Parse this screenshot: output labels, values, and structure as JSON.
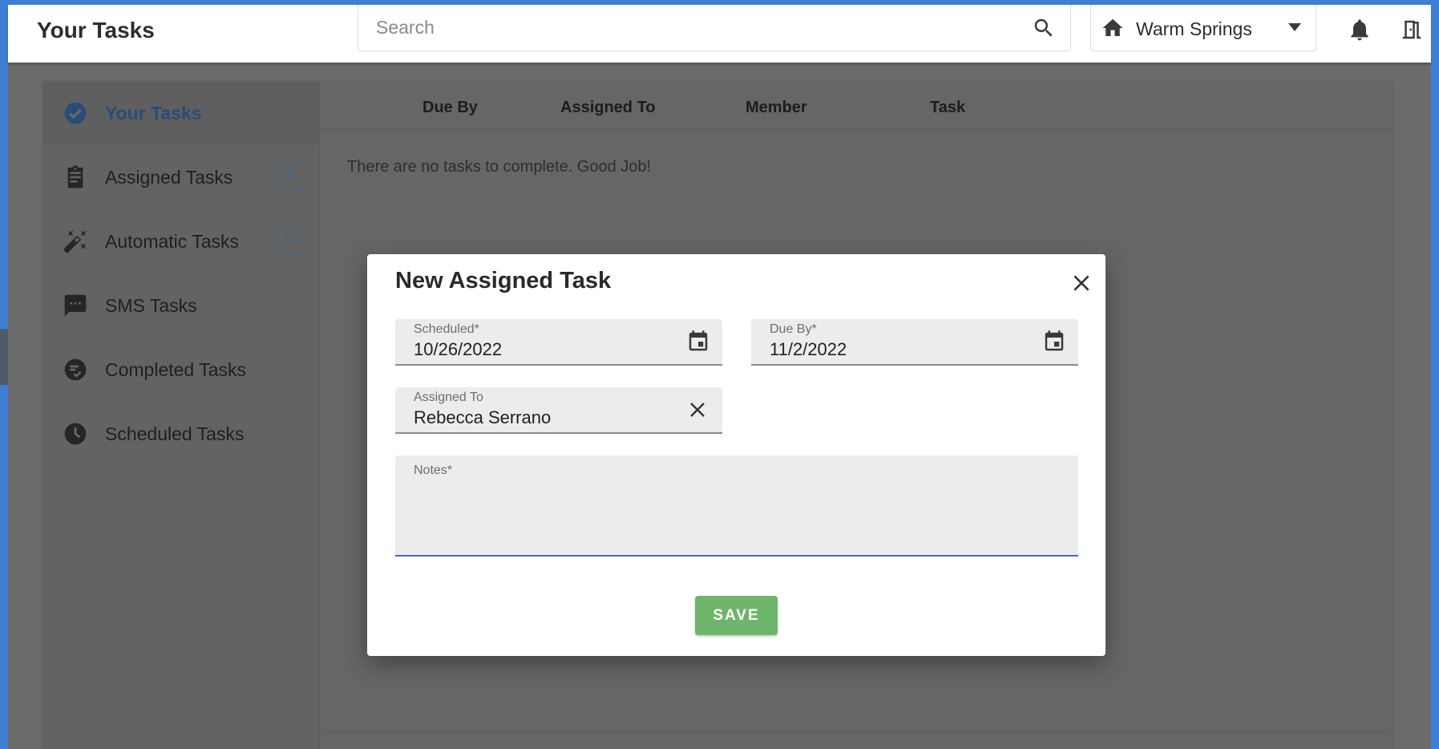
{
  "header": {
    "title": "Your Tasks",
    "search_placeholder": "Search",
    "location": "Warm Springs"
  },
  "sidebar": {
    "items": [
      {
        "label": "Your Tasks",
        "icon": "check-circle-icon",
        "active": true
      },
      {
        "label": "Assigned Tasks",
        "icon": "clipboard-icon",
        "badge": "5"
      },
      {
        "label": "Automatic Tasks",
        "icon": "magic-wand-icon",
        "badge": "21"
      },
      {
        "label": "SMS Tasks",
        "icon": "chat-bubble-icon"
      },
      {
        "label": "Completed Tasks",
        "icon": "checklist-icon"
      },
      {
        "label": "Scheduled Tasks",
        "icon": "clock-icon"
      }
    ]
  },
  "table": {
    "columns": [
      "Due By",
      "Assigned To",
      "Member",
      "Task"
    ],
    "empty_message": "There are no tasks to complete. Good Job!"
  },
  "modal": {
    "title": "New Assigned Task",
    "scheduled_label": "Scheduled*",
    "scheduled_value": "10/26/2022",
    "due_label": "Due By*",
    "due_value": "11/2/2022",
    "assigned_label": "Assigned To",
    "assigned_value": "Rebecca Serrano",
    "notes_label": "Notes*",
    "notes_value": "",
    "save_label": "SAVE"
  },
  "colors": {
    "accent_blue": "#3f7fd3",
    "active_nav_text": "#284d77",
    "save_green": "#6db56a",
    "badge": "#3f6a86"
  }
}
